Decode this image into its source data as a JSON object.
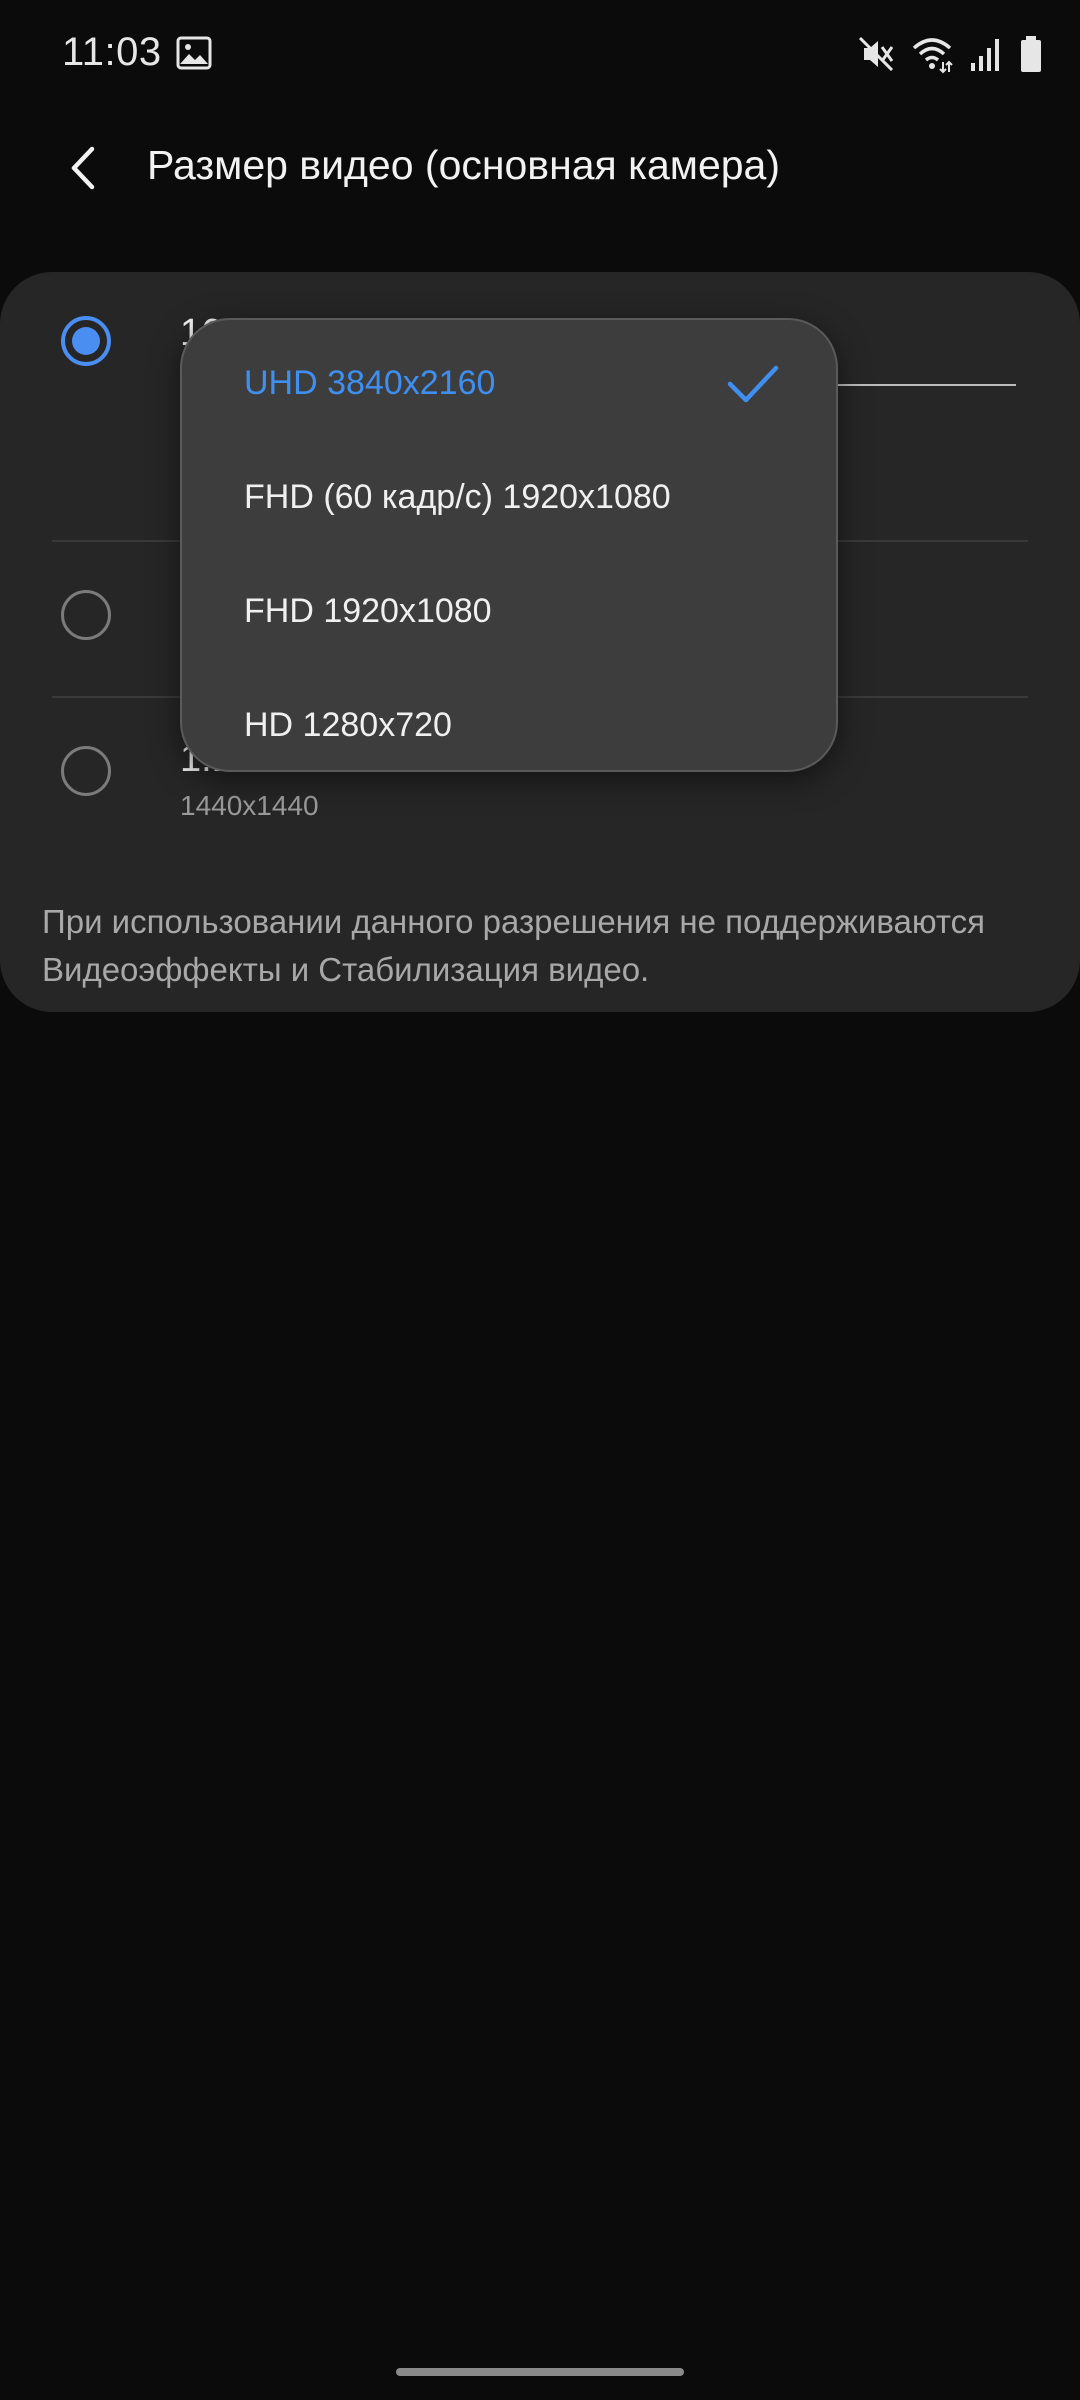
{
  "status_bar": {
    "time": "11:03",
    "icons": [
      "gallery-icon",
      "mute-icon",
      "wifi-icon",
      "signal-icon",
      "battery-icon"
    ]
  },
  "app_bar": {
    "title": "Размер видео (основная камера)"
  },
  "options": [
    {
      "title": "16:9",
      "subtitle": "",
      "selected": true
    },
    {
      "title": "",
      "subtitle": "",
      "selected": false
    },
    {
      "title": "1:1",
      "subtitle": "1440x1440",
      "selected": false
    }
  ],
  "note": "При использовании данного разрешения не поддерживаются Видеоэффекты и Стабилизация видео.",
  "popup": {
    "items": [
      {
        "label": "UHD 3840x2160",
        "selected": true
      },
      {
        "label": "FHD (60 кадр/с) 1920x1080",
        "selected": false
      },
      {
        "label": "FHD 1920x1080",
        "selected": false
      },
      {
        "label": "HD 1280x720",
        "selected": false
      }
    ]
  },
  "colors": {
    "background": "#0b0b0b",
    "card": "#262626",
    "popup": "#3d3d3d",
    "accent": "#3f8ff0",
    "radio_checked": "#4a8ef2"
  }
}
